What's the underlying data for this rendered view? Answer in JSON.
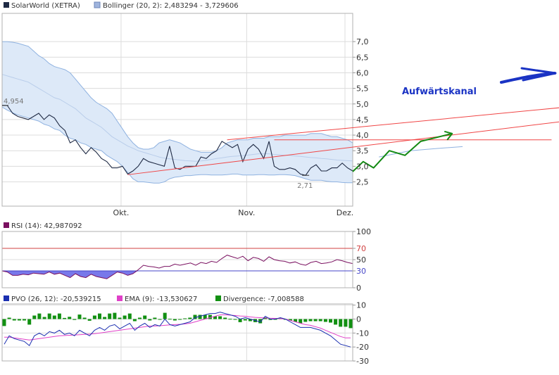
{
  "colors": {
    "price": "#1f2a44",
    "bollinger_fill": "#dde9f8",
    "bollinger_edge": "#8fb2e0",
    "bollinger_mid": "#b9cdea",
    "channel": "#f04545",
    "projection": "#138a13",
    "annotation": "#1a33c4",
    "rsi": "#7a1060",
    "rsi_band": "#d04040",
    "rsi_low_line": "#4646c8",
    "rsi_fill": "#7878ea",
    "pvo": "#1b2fb0",
    "ema": "#e040c8",
    "divergence": "#129012",
    "grid": "#dcdcdc",
    "frame": "#b0b0b0",
    "text": "#333333"
  },
  "icons": [
    "arrow-right-icon"
  ],
  "chart_data": [
    {
      "type": "line",
      "title": "",
      "legend": [
        {
          "label": "SolarWorld (XETRA)",
          "swatch": "#1f2a44"
        },
        {
          "label": "Bollinger (20, 2): 2,483294 - 3,729606",
          "swatch": "#9fb4dd"
        }
      ],
      "x_ticks": [
        "Okt.",
        "Nov.",
        "Dez."
      ],
      "y_ticks": [
        "2,5",
        "3,0",
        "3,5",
        "4,0",
        "4,5",
        "5,0",
        "5,5",
        "6,0",
        "6,5",
        "7,0"
      ],
      "y_tick_values": [
        2.5,
        3.0,
        3.5,
        4.0,
        4.5,
        5.0,
        5.5,
        6.0,
        6.5,
        7.0
      ],
      "ylim": [
        2.2,
        7.3
      ],
      "annotations": [
        {
          "label": "4,954",
          "index": 0,
          "value": 4.954
        },
        {
          "label": "2,71",
          "index": 58,
          "value": 2.71
        },
        {
          "label": "Aufwärtskanal"
        }
      ],
      "series": [
        {
          "name": "SolarWorld (XETRA)",
          "values": [
            4.954,
            4.95,
            4.7,
            4.6,
            4.55,
            4.5,
            4.6,
            4.7,
            4.5,
            4.65,
            4.55,
            4.3,
            4.15,
            3.75,
            3.85,
            3.6,
            3.4,
            3.6,
            3.45,
            3.25,
            3.15,
            2.95,
            2.95,
            3.0,
            2.75,
            2.85,
            3.0,
            3.25,
            3.15,
            3.1,
            3.05,
            3.0,
            3.65,
            2.95,
            2.9,
            3.0,
            3.0,
            3.0,
            3.3,
            3.25,
            3.4,
            3.5,
            3.8,
            3.7,
            3.6,
            3.7,
            3.15,
            3.55,
            3.7,
            3.55,
            3.25,
            3.8,
            3.0,
            2.9,
            2.9,
            2.95,
            2.9,
            2.75,
            2.71,
            2.95,
            3.05,
            2.85,
            2.85,
            2.95,
            2.95,
            3.1,
            2.95,
            2.85
          ]
        },
        {
          "name": "Bollinger (20, 2) upper",
          "values": [
            7.0,
            7.0,
            6.98,
            6.95,
            6.9,
            6.85,
            6.7,
            6.55,
            6.45,
            6.3,
            6.2,
            6.15,
            6.1,
            6.0,
            5.8,
            5.6,
            5.4,
            5.2,
            5.05,
            4.95,
            4.85,
            4.7,
            4.45,
            4.2,
            3.95,
            3.75,
            3.6,
            3.55,
            3.55,
            3.6,
            3.75,
            3.8,
            3.85,
            3.8,
            3.75,
            3.65,
            3.55,
            3.5,
            3.45,
            3.45,
            3.45,
            3.5,
            3.6,
            3.75,
            3.8,
            3.85,
            3.85,
            3.85,
            3.9,
            3.9,
            3.9,
            3.95,
            3.95,
            3.95,
            4.0,
            4.0,
            4.0,
            4.0,
            4.0,
            4.05,
            4.05,
            4.05,
            4.0,
            3.95,
            3.95,
            3.9,
            3.85,
            3.75
          ]
        },
        {
          "name": "Bollinger (20, 2) middle",
          "values": [
            5.95,
            5.9,
            5.85,
            5.8,
            5.75,
            5.7,
            5.6,
            5.5,
            5.4,
            5.3,
            5.2,
            5.15,
            5.05,
            4.95,
            4.85,
            4.7,
            4.55,
            4.45,
            4.35,
            4.25,
            4.1,
            3.95,
            3.85,
            3.75,
            3.65,
            3.58,
            3.5,
            3.45,
            3.4,
            3.35,
            3.3,
            3.26,
            3.24,
            3.22,
            3.2,
            3.18,
            3.17,
            3.16,
            3.17,
            3.19,
            3.22,
            3.25,
            3.27,
            3.3,
            3.32,
            3.33,
            3.34,
            3.36,
            3.38,
            3.4,
            3.4,
            3.4,
            3.38,
            3.37,
            3.35,
            3.35,
            3.33,
            3.32,
            3.3,
            3.28,
            3.27,
            3.25,
            3.24,
            3.22,
            3.2,
            3.19,
            3.18,
            3.17
          ]
        },
        {
          "name": "Bollinger (20, 2) lower",
          "values": [
            4.9,
            4.8,
            4.72,
            4.65,
            4.6,
            4.55,
            4.5,
            4.45,
            4.35,
            4.3,
            4.2,
            4.15,
            4.0,
            3.9,
            3.85,
            3.75,
            3.7,
            3.6,
            3.55,
            3.5,
            3.35,
            3.25,
            3.15,
            3.0,
            2.8,
            2.6,
            2.5,
            2.5,
            2.48,
            2.46,
            2.46,
            2.5,
            2.6,
            2.65,
            2.67,
            2.7,
            2.7,
            2.72,
            2.73,
            2.73,
            2.72,
            2.72,
            2.72,
            2.73,
            2.75,
            2.75,
            2.72,
            2.72,
            2.72,
            2.73,
            2.73,
            2.72,
            2.72,
            2.73,
            2.73,
            2.72,
            2.7,
            2.65,
            2.6,
            2.55,
            2.55,
            2.55,
            2.52,
            2.5,
            2.5,
            2.48,
            2.47,
            2.47
          ]
        },
        {
          "name": "Aufwärtskanal upper",
          "points": [
            [
              43,
              3.85
            ],
            [
              114,
              5.0
            ]
          ]
        },
        {
          "name": "Aufwärtskanal lower",
          "points": [
            [
              24,
              2.73
            ],
            [
              114,
              4.58
            ]
          ]
        },
        {
          "name": "Aufwärtskanal horizontal",
          "points": [
            [
              52,
              3.85
            ],
            [
              105,
              3.85
            ]
          ]
        },
        {
          "name": "Aufwärtskanal projection",
          "points": [
            [
              67,
              2.83
            ],
            [
              69,
              3.15
            ],
            [
              71,
              2.95
            ],
            [
              74,
              3.5
            ],
            [
              77,
              3.35
            ],
            [
              80,
              3.8
            ],
            [
              86,
              4.05
            ]
          ]
        },
        {
          "name": "Aufwärtskanal mid projection",
          "points": [
            [
              72,
              3.3
            ],
            [
              78,
              3.5
            ],
            [
              83,
              3.57
            ],
            [
              88,
              3.63
            ]
          ]
        }
      ]
    },
    {
      "type": "line",
      "title": "",
      "legend": [
        {
          "label": "RSI (14): 42,987092",
          "swatch": "#7a1060"
        }
      ],
      "y_ticks": [
        "0",
        "30",
        "50",
        "70",
        "100"
      ],
      "y_tick_values": [
        0,
        30,
        50,
        70,
        100
      ],
      "ylim": [
        0,
        100
      ],
      "bands": [
        30,
        70
      ],
      "series": [
        {
          "name": "RSI (14)",
          "values": [
            30,
            28,
            22,
            22,
            24,
            23,
            26,
            25,
            24,
            28,
            24,
            26,
            22,
            18,
            25,
            20,
            18,
            24,
            20,
            18,
            16,
            22,
            28,
            26,
            22,
            25,
            32,
            40,
            38,
            37,
            35,
            38,
            38,
            42,
            40,
            42,
            44,
            40,
            45,
            43,
            47,
            45,
            52,
            58,
            55,
            52,
            56,
            48,
            54,
            52,
            47,
            55,
            50,
            48,
            47,
            44,
            46,
            42,
            40,
            45,
            47,
            43,
            44,
            46,
            50,
            48,
            45,
            43
          ]
        }
      ]
    },
    {
      "type": "bar",
      "title": "",
      "legend": [
        {
          "label": "PVO (26, 12): -20,539215",
          "swatch": "#1b2fb0"
        },
        {
          "label": "EMA (9): -13,530627",
          "swatch": "#e040c8"
        },
        {
          "label": "Divergence: -7,008588",
          "swatch": "#129012"
        }
      ],
      "y_ticks": [
        "-30",
        "-20",
        "-10",
        "0",
        "10"
      ],
      "y_tick_values": [
        -30,
        -20,
        -10,
        0,
        10
      ],
      "ylim": [
        -30,
        12
      ],
      "series": [
        {
          "name": "PVO (26, 12)",
          "values": [
            -18,
            -12,
            -14,
            -15,
            -16,
            -19,
            -12,
            -10,
            -12,
            -9,
            -10,
            -8,
            -11,
            -10,
            -12,
            -8,
            -10,
            -12,
            -8,
            -6,
            -8,
            -5,
            -4,
            -7,
            -5,
            -3,
            -8,
            -5,
            -3,
            -6,
            -4,
            -5,
            0,
            -4,
            -5,
            -4,
            -3,
            -2,
            1,
            2,
            3,
            4,
            4,
            5,
            4,
            3,
            2,
            0,
            1,
            0,
            -1,
            -2,
            2,
            0,
            0,
            1,
            0,
            -2,
            -4,
            -6,
            -6,
            -6,
            -7,
            -8,
            -10,
            -12,
            -15,
            -18,
            -19,
            -20
          ]
        },
        {
          "name": "EMA (9)",
          "values": [
            -13,
            -13,
            -13.5,
            -14,
            -14.5,
            -15,
            -14.5,
            -14,
            -13.5,
            -13,
            -12.5,
            -12,
            -11.8,
            -11.6,
            -11.4,
            -11.2,
            -11,
            -10.8,
            -10.5,
            -10,
            -9.5,
            -9,
            -8.5,
            -8,
            -7.5,
            -7,
            -6.5,
            -6,
            -5.5,
            -5,
            -5,
            -4.8,
            -4.5,
            -4.2,
            -4,
            -3.8,
            -3.5,
            -3,
            -2,
            -1,
            0,
            1,
            2,
            3,
            3,
            2.8,
            2.5,
            2.2,
            2,
            1.5,
            1.2,
            1,
            0.8,
            0.6,
            0.5,
            0.3,
            0,
            -1,
            -2,
            -3,
            -4,
            -4.5,
            -5.5,
            -6.5,
            -8,
            -9.5,
            -11,
            -12.5,
            -13.5,
            -13.5
          ]
        },
        {
          "name": "Divergence",
          "values": [
            -5,
            1,
            -1,
            -1,
            -1,
            -4,
            2.5,
            4,
            1.5,
            4,
            2.5,
            4,
            0.8,
            1.6,
            -0.6,
            3.2,
            1,
            -1.2,
            2.5,
            4,
            1.5,
            4,
            4.5,
            1,
            2.5,
            4,
            -1.5,
            1,
            2.5,
            -1,
            1,
            -0.2,
            4.5,
            0.2,
            -1,
            -0.2,
            0.5,
            1,
            3,
            3,
            3,
            3,
            2,
            2,
            1,
            0.2,
            -0.5,
            -2.2,
            -1,
            -1.5,
            -2.2,
            -3,
            1.2,
            -0.6,
            -0.5,
            0.7,
            0,
            -1,
            -2,
            -3,
            -2,
            -1.5,
            -1.5,
            -1.5,
            -2,
            -2.5,
            -4,
            -5.5,
            -5.5,
            -6.5
          ]
        }
      ]
    }
  ]
}
